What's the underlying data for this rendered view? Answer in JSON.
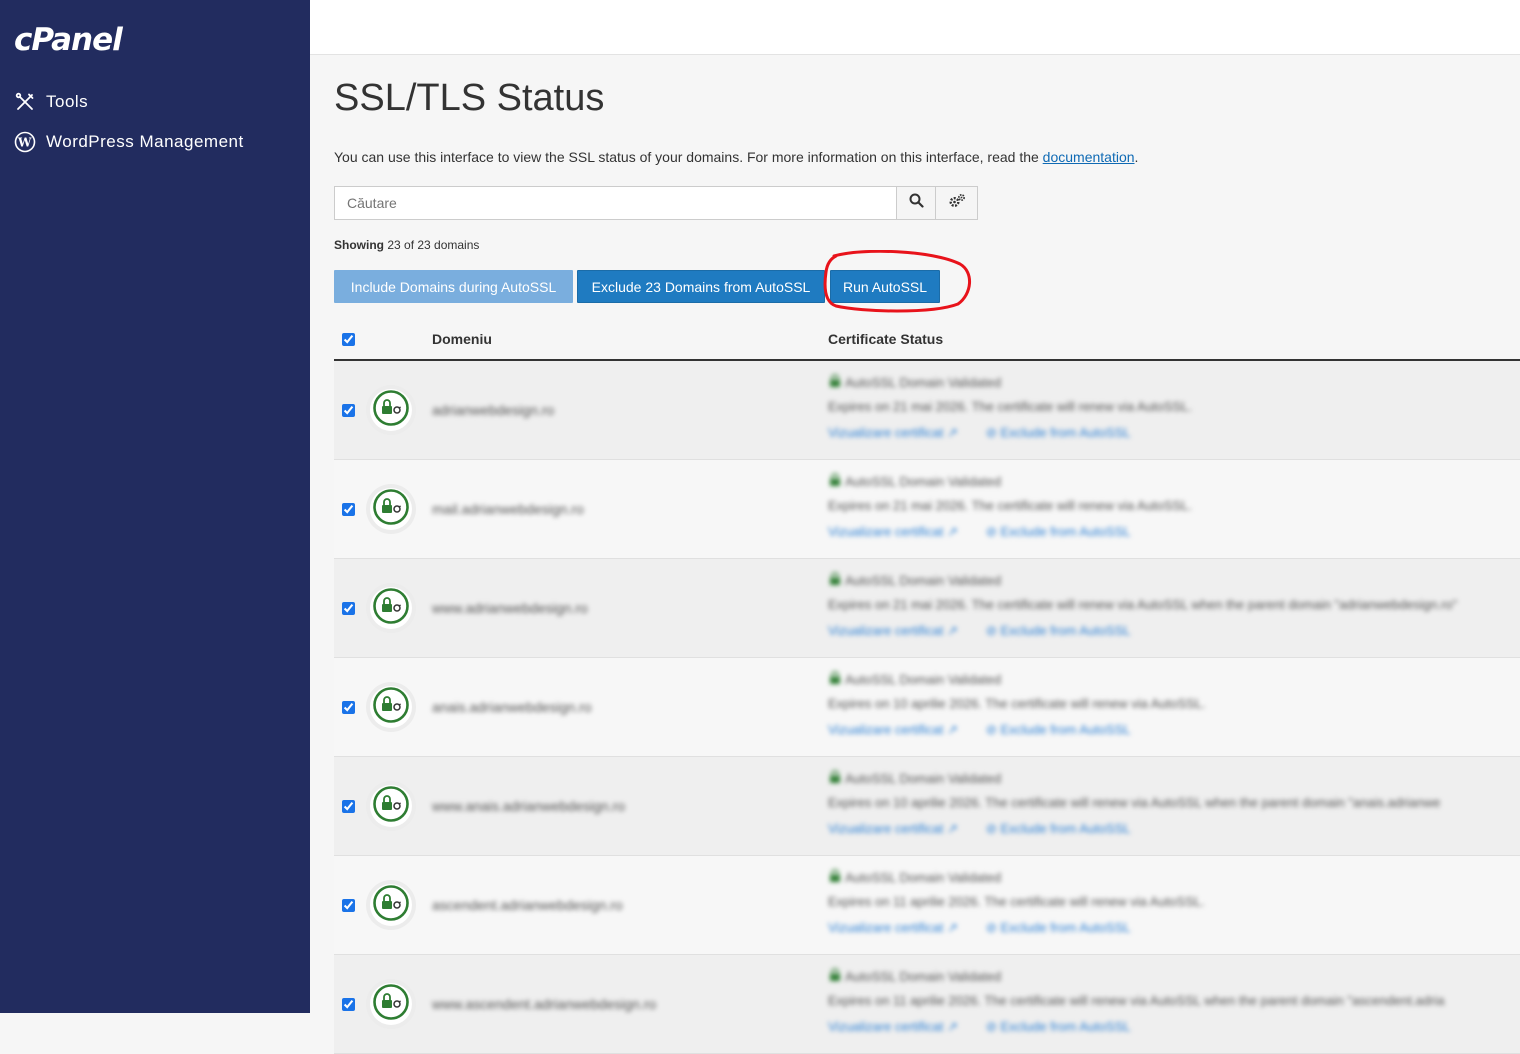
{
  "sidebar": {
    "logo": "cPanel",
    "items": [
      {
        "label": "Tools",
        "icon": "tools-icon"
      },
      {
        "label": "WordPress Management",
        "icon": "wordpress-icon"
      }
    ]
  },
  "page": {
    "title": "SSL/TLS Status",
    "intro_text": "You can use this interface to view the SSL status of your domains. For more information on this interface, read the ",
    "intro_link": "documentation",
    "intro_end": "."
  },
  "search": {
    "placeholder": "Căutare",
    "value": ""
  },
  "showing": {
    "label": "Showing",
    "text": " 23 of 23 domains"
  },
  "buttons": {
    "include": "Include Domains during AutoSSL",
    "exclude": "Exclude 23 Domains from AutoSSL",
    "run": "Run AutoSSL"
  },
  "table": {
    "headers": {
      "domain": "Domeniu",
      "status": "Certificate Status"
    },
    "rows": [
      {
        "domain": "adrianwebdesign.ro",
        "status": "AutoSSL Domain Validated",
        "expires": "Expires on 21 mai 2026. The certificate will renew via AutoSSL.",
        "view": "Vizualizare certificat",
        "exclude": "Exclude from AutoSSL"
      },
      {
        "domain": "mail.adrianwebdesign.ro",
        "status": "AutoSSL Domain Validated",
        "expires": "Expires on 21 mai 2026. The certificate will renew via AutoSSL.",
        "view": "Vizualizare certificat",
        "exclude": "Exclude from AutoSSL"
      },
      {
        "domain": "www.adrianwebdesign.ro",
        "status": "AutoSSL Domain Validated",
        "expires": "Expires on 21 mai 2026. The certificate will renew via AutoSSL when the parent domain \"adrianwebdesign.ro\"",
        "view": "Vizualizare certificat",
        "exclude": "Exclude from AutoSSL"
      },
      {
        "domain": "anais.adrianwebdesign.ro",
        "status": "AutoSSL Domain Validated",
        "expires": "Expires on 10 aprilie 2026. The certificate will renew via AutoSSL.",
        "view": "Vizualizare certificat",
        "exclude": "Exclude from AutoSSL"
      },
      {
        "domain": "www.anais.adrianwebdesign.ro",
        "status": "AutoSSL Domain Validated",
        "expires": "Expires on 10 aprilie 2026. The certificate will renew via AutoSSL when the parent domain \"anais.adrianwe",
        "view": "Vizualizare certificat",
        "exclude": "Exclude from AutoSSL"
      },
      {
        "domain": "ascendent.adrianwebdesign.ro",
        "status": "AutoSSL Domain Validated",
        "expires": "Expires on 11 aprilie 2026. The certificate will renew via AutoSSL.",
        "view": "Vizualizare certificat",
        "exclude": "Exclude from AutoSSL"
      },
      {
        "domain": "www.ascendent.adrianwebdesign.ro",
        "status": "AutoSSL Domain Validated",
        "expires": "Expires on 11 aprilie 2026. The certificate will renew via AutoSSL when the parent domain \"ascendent.adria",
        "view": "Vizualizare certificat",
        "exclude": "Exclude from AutoSSL"
      }
    ]
  },
  "colors": {
    "sidebar_bg": "#222c5f",
    "button_primary": "#1f7bc1",
    "button_disabled": "#7aaede",
    "highlight_annotation": "#e8131b",
    "badge_green": "#2e7d32",
    "link": "#2a7fd4"
  }
}
